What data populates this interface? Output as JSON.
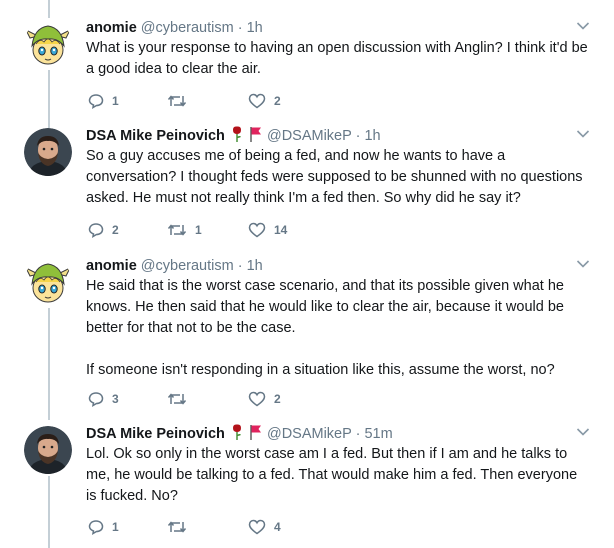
{
  "tweets": [
    {
      "name": "anomie",
      "handle": "@cyberautism",
      "sep": "·",
      "time": "1h",
      "avatar": "anime-elf-avatar",
      "emoji": [],
      "text": "What is your response to having an open discussion with Anglin? I think it'd be a good idea to clear the air.",
      "replies": "1",
      "retweets": "",
      "likes": "2"
    },
    {
      "name": "DSA Mike Peinovich",
      "handle": "@DSAMikeP",
      "sep": "·",
      "time": "1h",
      "avatar": "bearded-man-avatar",
      "emoji": [
        "rose-emoji",
        "red-flag-emoji"
      ],
      "text": "So a guy accuses me of being a fed, and now he wants to have a conversation? I thought feds were supposed to be shunned with no questions asked. He must not really think I'm a fed then. So why did he say it?",
      "replies": "2",
      "retweets": "1",
      "likes": "14"
    },
    {
      "name": "anomie",
      "handle": "@cyberautism",
      "sep": "·",
      "time": "1h",
      "avatar": "anime-elf-avatar",
      "emoji": [],
      "text": "He said that is the worst case scenario, and that its possible given what he knows. He then said that he would like to clear the air, because it would be better for that not to be the case.\n\nIf someone isn't responding in a situation like this, assume the worst, no?",
      "replies": "3",
      "retweets": "",
      "likes": "2"
    },
    {
      "name": "DSA Mike Peinovich",
      "handle": "@DSAMikeP",
      "sep": "·",
      "time": "51m",
      "avatar": "bearded-man-avatar",
      "emoji": [
        "rose-emoji",
        "red-flag-emoji"
      ],
      "text": "Lol. Ok so only in the worst case am I a fed. But then if I am and he talks to me, he would be talking to a fed. That would make him a fed. Then everyone is fucked. No?",
      "replies": "1",
      "retweets": "",
      "likes": "4"
    }
  ],
  "colors": {
    "text": "#14171a",
    "muted": "#657786",
    "thread_line": "#c4cfd6",
    "rose": "#b3121a",
    "flag": "#e0245e"
  }
}
